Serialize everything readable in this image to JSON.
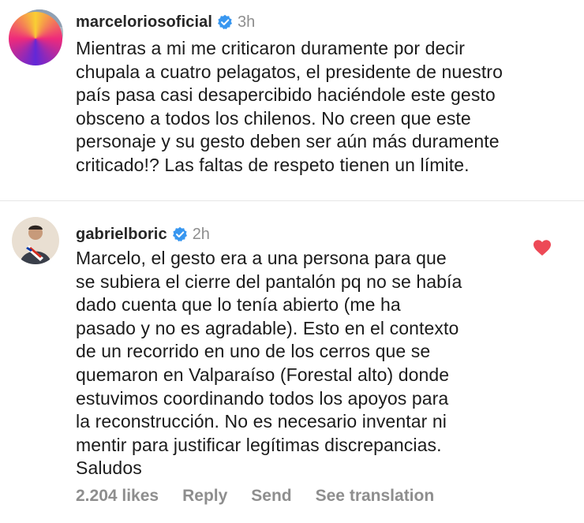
{
  "comments": [
    {
      "username": "marceloriosoficial",
      "time": "3h",
      "avatar_icon": "profile-photo",
      "verified_icon": "verified-badge-icon",
      "text": "Mientras a mi me criticaron duramente por decir\nchupala a cuatro pelagatos, el presidente de nuestro\npaís pasa casi desapercibido haciéndole este gesto\nobsceno a todos los chilenos. No creen que este\npersonaje y su gesto deben ser aún más duramente\ncriticado!? Las faltas de respeto tienen un límite."
    },
    {
      "username": "gabrielboric",
      "time": "2h",
      "avatar_icon": "profile-photo",
      "verified_icon": "verified-badge-icon",
      "liked_icon": "heart-filled-icon",
      "text": "Marcelo, el gesto era a una persona para que\nse subiera el cierre del pantalón pq no se había\ndado cuenta que lo tenía abierto (me ha\npasado y no es agradable). Esto en el contexto\nde un recorrido en uno de los cerros que se\nquemaron en Valparaíso (Forestal alto) donde\nestuvimos coordinando todos los apoyos para\nla reconstrucción. No es necesario inventar ni\nmentir para justificar legítimas discrepancias.\nSaludos",
      "actions": {
        "likes": "2.204 likes",
        "reply": "Reply",
        "send": "Send",
        "translate": "See translation"
      }
    }
  ],
  "colors": {
    "verified": "#3897f0",
    "heart": "#ed4956",
    "secondary_text": "#8e8e8e"
  }
}
